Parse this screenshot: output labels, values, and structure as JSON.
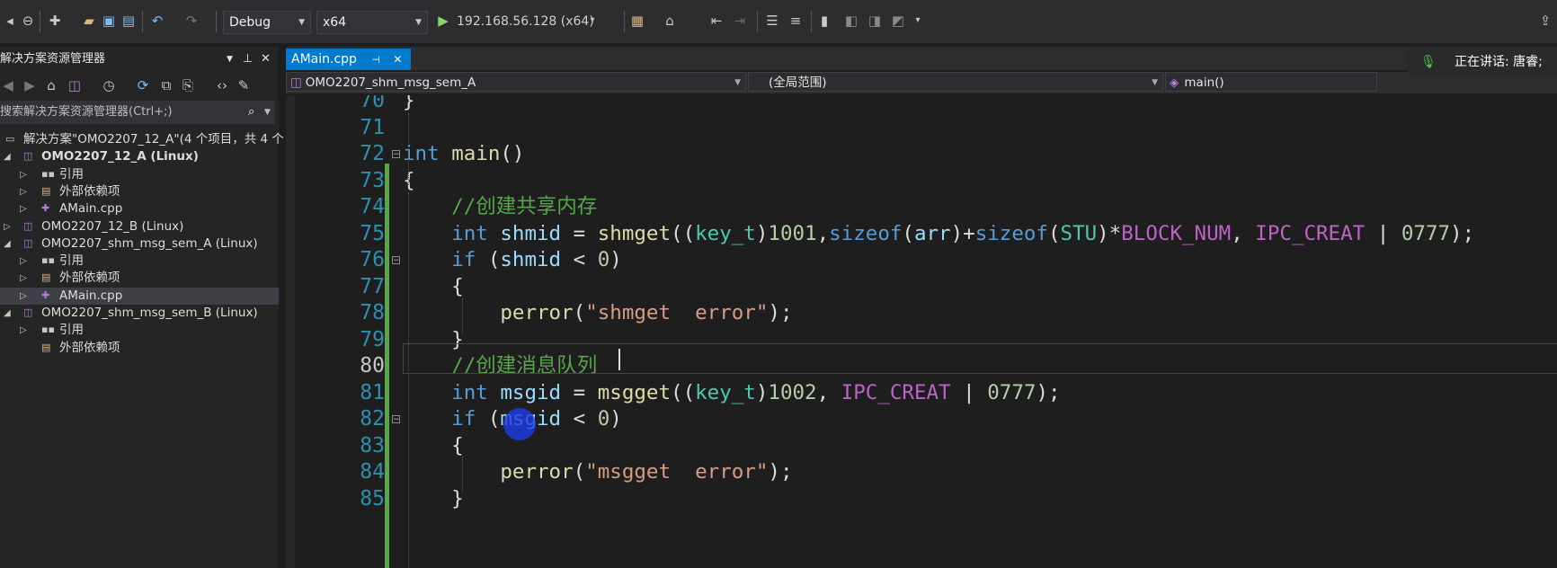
{
  "toolbar": {
    "config": "Debug",
    "platform": "x64",
    "remote_target": "192.168.56.128 (x64)",
    "icons": [
      "nav-back-icon",
      "new-project-icon",
      "open-folder-icon",
      "save-icon",
      "save-all-icon",
      "undo-icon",
      "redo-icon",
      "play-icon",
      "file-explorer-icon",
      "home-icon",
      "comment-icon",
      "uncomment-icon",
      "bookmark-icon",
      "bookmark-prev-icon",
      "bookmark-next-icon",
      "share-icon"
    ]
  },
  "solution_explorer": {
    "title": "解决方案资源管理器",
    "search_placeholder": "搜索解决方案资源管理器(Ctrl+;)",
    "rows": [
      {
        "label": "解决方案\"OMO2207_12_A\"(4 个项目，共 4 个",
        "icon": "solution-icon",
        "caret": "",
        "bold": false,
        "selected": false
      },
      {
        "label": "OMO2207_12_A (Linux)",
        "icon": "linux-project-icon",
        "caret": "expanded",
        "bold": true,
        "selected": false
      },
      {
        "label": "引用",
        "icon": "references-icon",
        "caret": "collapsed",
        "bold": false,
        "selected": false
      },
      {
        "label": "外部依赖项",
        "icon": "external-deps-icon",
        "caret": "collapsed",
        "bold": false,
        "selected": false
      },
      {
        "label": "AMain.cpp",
        "icon": "cpp-file-icon",
        "caret": "collapsed",
        "bold": false,
        "selected": false
      },
      {
        "label": "OMO2207_12_B (Linux)",
        "icon": "linux-project-icon",
        "caret": "collapsed",
        "bold": false,
        "selected": false
      },
      {
        "label": "OMO2207_shm_msg_sem_A (Linux)",
        "icon": "linux-project-icon",
        "caret": "expanded",
        "bold": false,
        "selected": false
      },
      {
        "label": "引用",
        "icon": "references-icon",
        "caret": "collapsed",
        "bold": false,
        "selected": false
      },
      {
        "label": "外部依赖项",
        "icon": "external-deps-icon",
        "caret": "collapsed",
        "bold": false,
        "selected": false
      },
      {
        "label": "AMain.cpp",
        "icon": "cpp-file-icon",
        "caret": "collapsed",
        "bold": false,
        "selected": true
      },
      {
        "label": "OMO2207_shm_msg_sem_B (Linux)",
        "icon": "linux-project-icon",
        "caret": "expanded",
        "bold": false,
        "selected": false
      },
      {
        "label": "引用",
        "icon": "references-icon",
        "caret": "collapsed",
        "bold": false,
        "selected": false
      },
      {
        "label": "外部依赖项",
        "icon": "external-deps-icon",
        "caret": "",
        "bold": false,
        "selected": false
      }
    ]
  },
  "editor": {
    "tab_label": "AMain.cpp",
    "nav_project": "OMO2207_shm_msg_sem_A",
    "nav_scope": "(全局范围)",
    "nav_member": "main()",
    "lines": [
      {
        "num": "70",
        "text": "}"
      },
      {
        "num": "71",
        "text": ""
      },
      {
        "num": "72",
        "text": "int main()"
      },
      {
        "num": "73",
        "text": "{"
      },
      {
        "num": "74",
        "text": "    //创建共享内存"
      },
      {
        "num": "75",
        "text": "    int shmid = shmget((key_t)1001,sizeof(arr)+sizeof(STU)*BLOCK_NUM, IPC_CREAT | 0777);"
      },
      {
        "num": "76",
        "text": "    if (shmid < 0)"
      },
      {
        "num": "77",
        "text": "    {"
      },
      {
        "num": "78",
        "text": "        perror(\"shmget  error\");"
      },
      {
        "num": "79",
        "text": "    }"
      },
      {
        "num": "80",
        "text": "    //创建消息队列"
      },
      {
        "num": "81",
        "text": "    int msgid = msgget((key_t)1002, IPC_CREAT | 0777);"
      },
      {
        "num": "82",
        "text": "    if (msgid < 0)"
      },
      {
        "num": "83",
        "text": "    {"
      },
      {
        "num": "84",
        "text": "        perror(\"msgget  error\");"
      },
      {
        "num": "85",
        "text": "    }"
      }
    ]
  },
  "voice_overlay": {
    "text": "正在讲话: 唐睿;"
  }
}
